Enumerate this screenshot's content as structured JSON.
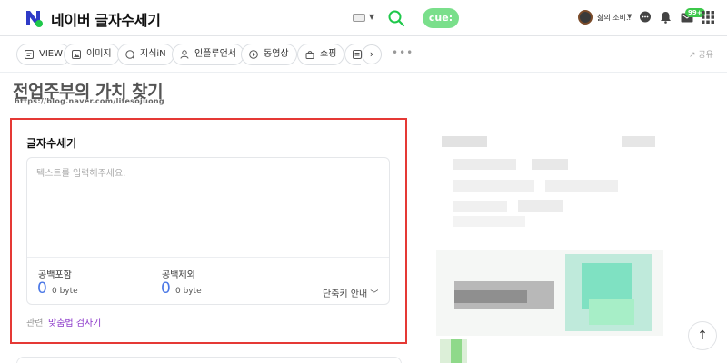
{
  "header": {
    "title": "네이버 글자수세기",
    "cue_label": "cue:",
    "user_name": "삶의 소비..",
    "mail_badge": "99+"
  },
  "tabs": [
    {
      "label": "VIEW",
      "icon": "view-icon"
    },
    {
      "label": "이미지",
      "icon": "image-icon"
    },
    {
      "label": "지식iN",
      "icon": "kin-icon"
    },
    {
      "label": "인플루언서",
      "icon": "person-icon"
    },
    {
      "label": "동영상",
      "icon": "play-icon"
    },
    {
      "label": "쇼핑",
      "icon": "bag-icon"
    }
  ],
  "tab_bar": {
    "more_label": "•••",
    "share_label": "공유"
  },
  "blog": {
    "title": "전업주부의 가치 찾기",
    "url": "https://blog.naver.com/lifesojuong"
  },
  "counter": {
    "title": "글자수세기",
    "placeholder": "텍스트를 입력해주세요.",
    "with_space_label": "공백포함",
    "with_space_value": "0",
    "with_space_unit": "0 byte",
    "without_space_label": "공백제외",
    "without_space_value": "0",
    "without_space_unit": "0 byte",
    "shortcut_label": "단축키 안내",
    "related_label": "관련",
    "related_link": "맞춤법 검사기"
  },
  "colors": {
    "accent_green": "#7adf8b",
    "number_blue": "#4b78e6",
    "link_purple": "#8a35c9",
    "highlight_red": "#e53935"
  }
}
